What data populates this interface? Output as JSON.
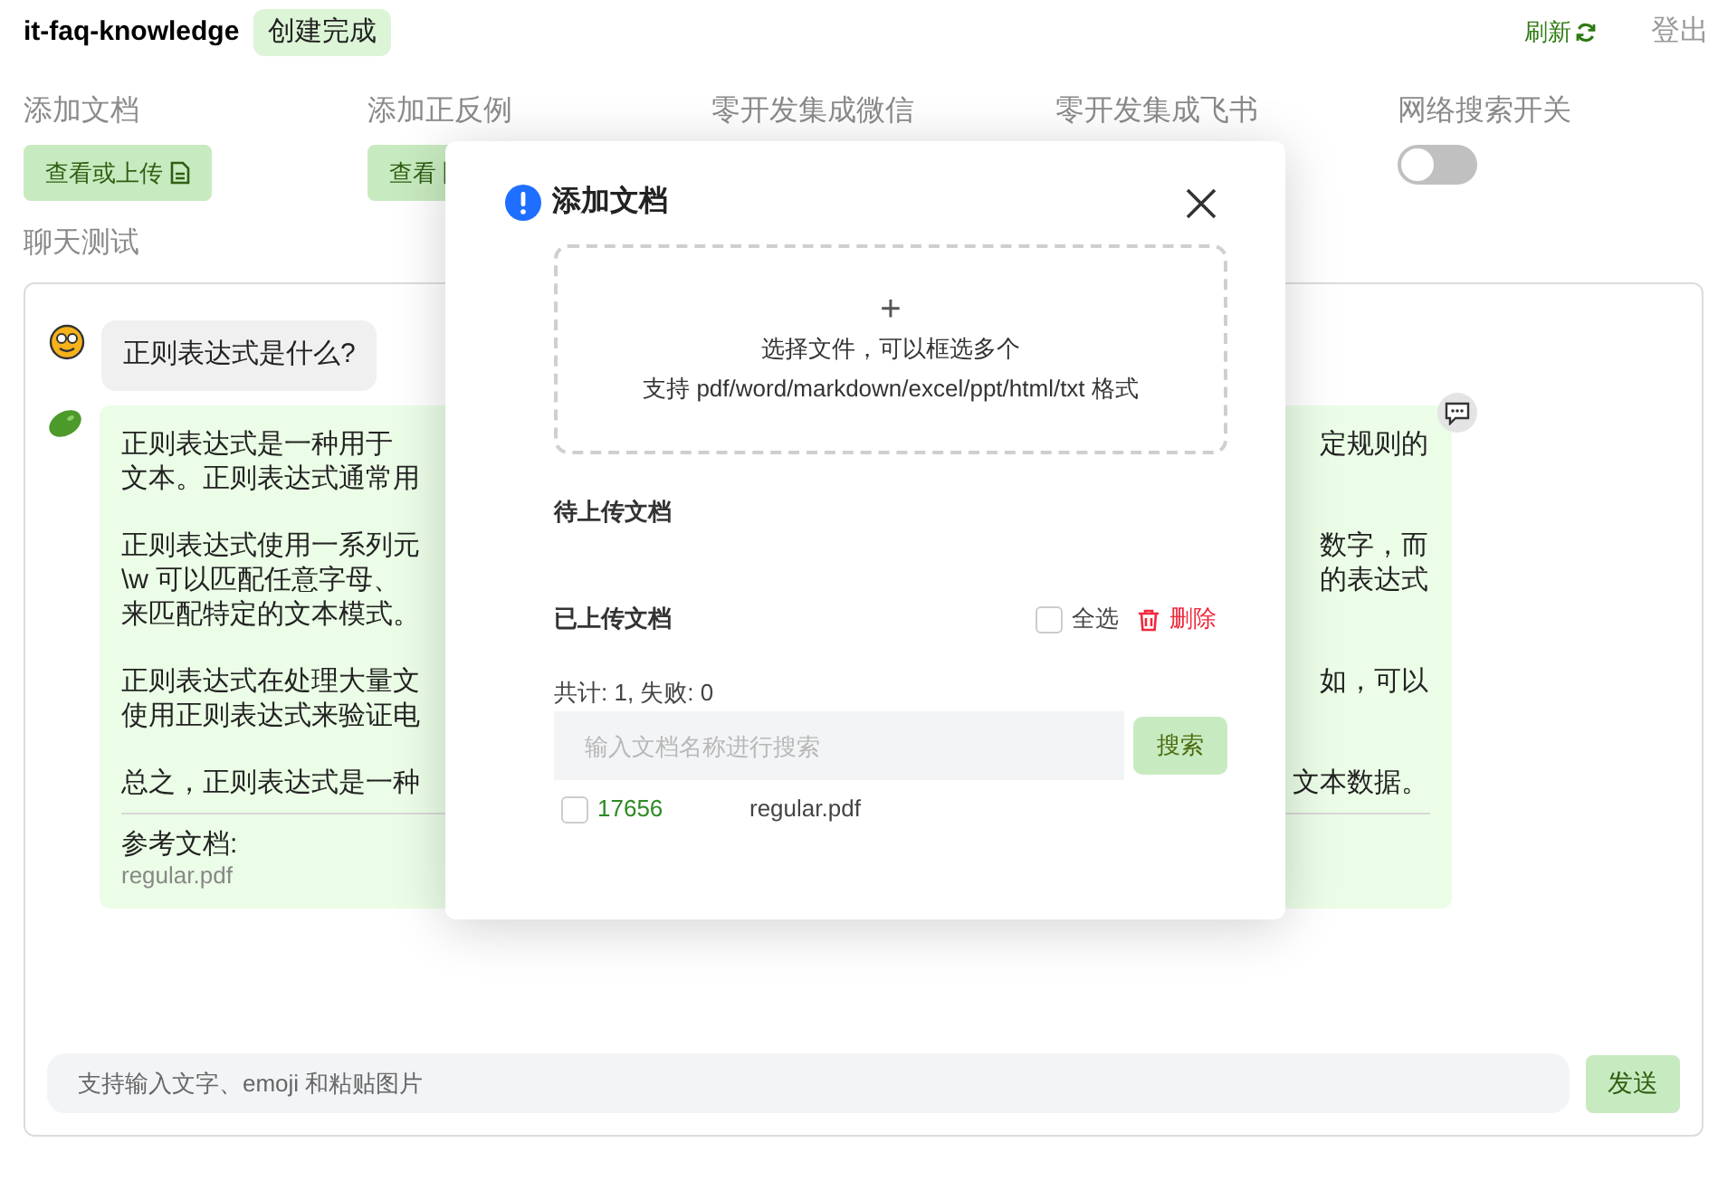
{
  "header": {
    "title": "it-faq-knowledge",
    "status": "创建完成",
    "refresh": "刷新",
    "logout": "登出"
  },
  "features": [
    {
      "label": "添加文档",
      "kind": "button",
      "button": "查看或上传"
    },
    {
      "label": "添加正反例",
      "kind": "button",
      "button": "查看"
    },
    {
      "label": "零开发集成微信",
      "kind": "label"
    },
    {
      "label": "零开发集成飞书",
      "kind": "label"
    },
    {
      "label": "网络搜索开关",
      "kind": "toggle",
      "on": false
    }
  ],
  "chat_label": "聊天测试",
  "messages": [
    {
      "kind": "user",
      "text": "正则表达式是什么?"
    },
    {
      "kind": "assistant",
      "paragraphs": [
        [
          {
            "left": "正则表达式是一种用于",
            "right": "定规则的"
          },
          {
            "left": "文本。正则表达式通常用"
          }
        ],
        [
          {
            "left": "正则表达式使用一系列元",
            "right": "数字，而"
          },
          {
            "left": "\\w 可以匹配任意字母、",
            "right": "的表达式"
          },
          {
            "left": "来匹配特定的文本模式。"
          }
        ],
        [
          {
            "left": "正则表达式在处理大量文",
            "right": "如，可以"
          },
          {
            "left": "使用正则表达式来验证电"
          }
        ],
        [
          {
            "left": "总之，正则表达式是一种",
            "right": "文本数据。"
          }
        ]
      ],
      "reference_label": "参考文档:",
      "reference_file": "regular.pdf"
    }
  ],
  "input": {
    "placeholder": "支持输入文字、emoji 和粘贴图片"
  },
  "send": "发送",
  "modal": {
    "title": "添加文档",
    "upload_plus": "+",
    "upload_hint": "选择文件，可以框选多个",
    "upload_formats": "支持 pdf/word/markdown/excel/ppt/html/txt 格式",
    "pending_label": "待上传文档",
    "uploaded_label": "已上传文档",
    "select_all": {
      "label": "全选",
      "checked": false
    },
    "delete": "删除",
    "stats": "共计: 1, 失败: 0",
    "search": {
      "placeholder": "输入文档名称进行搜索"
    },
    "search_button": "搜索",
    "files": [
      {
        "id": "17656",
        "name": "regular.pdf",
        "checked": false
      }
    ]
  }
}
